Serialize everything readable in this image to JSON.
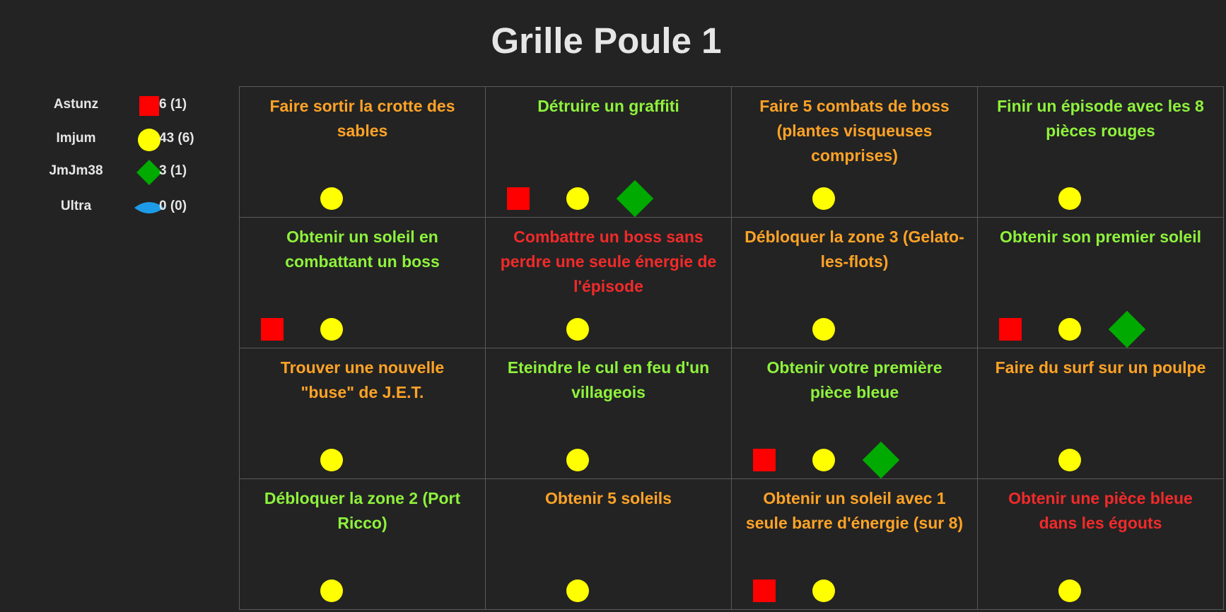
{
  "title": "Grille Poule 1",
  "colors": {
    "square": "#ff0000",
    "circle": "#ffff00",
    "diamond": "#00aa00",
    "eye": "#1e9be8",
    "easy": "#8ef23c",
    "medium": "#ffa326",
    "hard": "#f22a2a"
  },
  "players": [
    {
      "name": "Astunz",
      "shape": "square",
      "score": "6 (1)"
    },
    {
      "name": "Imjum",
      "shape": "circle",
      "score": "43 (6)"
    },
    {
      "name": "JmJm38",
      "shape": "diamond",
      "score": "3 (1)"
    },
    {
      "name": "Ultra",
      "shape": "eye",
      "score": "0 (0)"
    }
  ],
  "cells": [
    {
      "text": "Faire sortir la crotte des sables",
      "difficulty": "medium",
      "marks": [
        "circle"
      ]
    },
    {
      "text": "Détruire un graffiti",
      "difficulty": "easy",
      "marks": [
        "square",
        "circle",
        "diamond"
      ]
    },
    {
      "text": "Faire 5 combats de boss (plantes visqueuses comprises)",
      "difficulty": "medium",
      "marks": [
        "circle"
      ]
    },
    {
      "text": "Finir un épisode avec les 8 pièces rouges",
      "difficulty": "easy",
      "marks": [
        "circle"
      ]
    },
    {
      "text": "Obtenir un soleil en combattant un boss",
      "difficulty": "easy",
      "marks": [
        "square",
        "circle"
      ]
    },
    {
      "text": "Combattre un boss sans perdre une seule énergie de l'épisode",
      "difficulty": "hard",
      "marks": [
        "circle"
      ]
    },
    {
      "text": "Débloquer la zone 3 (Gelato-les-flots)",
      "difficulty": "medium",
      "marks": [
        "circle"
      ]
    },
    {
      "text": "Obtenir son premier soleil",
      "difficulty": "easy",
      "marks": [
        "square",
        "circle",
        "diamond"
      ]
    },
    {
      "text": "Trouver une nouvelle \"buse\" de J.E.T.",
      "difficulty": "medium",
      "marks": [
        "circle"
      ]
    },
    {
      "text": "Eteindre le cul en feu d'un villageois",
      "difficulty": "easy",
      "marks": [
        "circle"
      ]
    },
    {
      "text": "Obtenir votre première pièce bleue",
      "difficulty": "easy",
      "marks": [
        "square",
        "circle",
        "diamond"
      ]
    },
    {
      "text": "Faire du surf sur un poulpe",
      "difficulty": "medium",
      "marks": [
        "circle"
      ]
    },
    {
      "text": "Débloquer la zone 2 (Port Ricco)",
      "difficulty": "easy",
      "marks": [
        "circle"
      ]
    },
    {
      "text": "Obtenir 5 soleils",
      "difficulty": "medium",
      "marks": [
        "circle"
      ]
    },
    {
      "text": "Obtenir un soleil avec 1 seule barre d'énergie (sur 8)",
      "difficulty": "medium",
      "marks": [
        "square",
        "circle"
      ]
    },
    {
      "text": "Obtenir une pièce bleue dans les égouts",
      "difficulty": "hard",
      "marks": [
        "circle"
      ]
    }
  ]
}
